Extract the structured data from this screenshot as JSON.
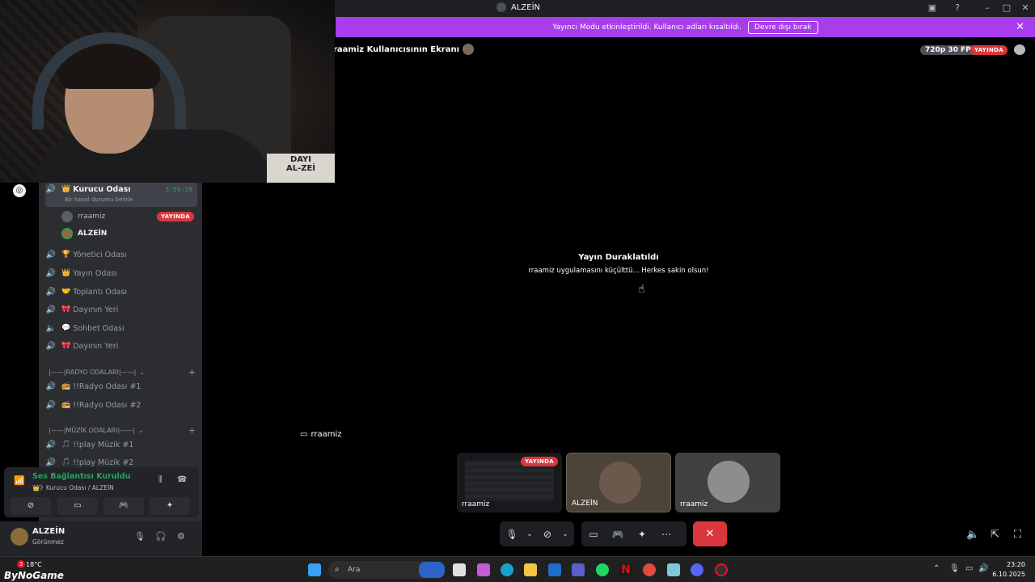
{
  "window": {
    "title": "ALZEİN"
  },
  "banner": {
    "message": "Yayıncı Modu etkinleştirildi. Kullanıcı adları kısaltıldı.",
    "button": "Devre dışı bırak"
  },
  "stage": {
    "title": "raamiz Kullanıcısının Ekranı",
    "quality": "720p 30 FPS",
    "live": "YAYINDA",
    "paused_title": "Yayın Duraklatıldı",
    "paused_sub": "rraamiz uygulamasını küçülttü... Herkes sakin olsun!",
    "label": "rraamiz"
  },
  "sidebar": {
    "active_channel": {
      "emoji": "👑",
      "name": "Kurucu Odası",
      "timer": "3:59:19",
      "status": "Bir kanal durumu belirle"
    },
    "members": [
      {
        "name": "rraamiz",
        "badge": "YAYINDA"
      },
      {
        "name": "ALZEİN"
      }
    ],
    "channels": [
      {
        "emoji": "🏆",
        "name": "Yönetici Odası"
      },
      {
        "emoji": "👑",
        "name": "Yayın Odası"
      },
      {
        "emoji": "🤝",
        "name": "Toplantı Odası"
      },
      {
        "emoji": "🎀",
        "name": "Dayının Yeri"
      },
      {
        "emoji": "💬",
        "name": "Sohbet Odası"
      },
      {
        "emoji": "🎀",
        "name": "Dayının Yeri"
      }
    ],
    "radio_category": "|——|RADYO ODALARI|——|",
    "radio_channels": [
      {
        "emoji": "📻",
        "name": "!!Radyo Odası #1"
      },
      {
        "emoji": "📻",
        "name": "!!Radyo Odası #2"
      }
    ],
    "music_category": "|——|MÜZİK ODALARI|——|",
    "music_channels": [
      {
        "emoji": "🎵",
        "name": "!!play Müzik #1"
      },
      {
        "emoji": "🎵",
        "name": "!!play Müzik #2"
      }
    ]
  },
  "voice": {
    "state": "Ses Bağlantısı Kuruldu",
    "location": "👑》Kurucu Odası / ALZEİN"
  },
  "user": {
    "name": "ALZEİN",
    "status": "Görünmez"
  },
  "thumbs": [
    {
      "name": "rraamiz",
      "badge": "YAYINDA"
    },
    {
      "name": "ALZEİN"
    },
    {
      "name": "rraamiz"
    }
  ],
  "taskbar": {
    "search_placeholder": "Ara",
    "temp": "18°C",
    "brand": "ByNoGame",
    "notif_count": "3",
    "time": "23:20",
    "date": "6.10.2025"
  }
}
